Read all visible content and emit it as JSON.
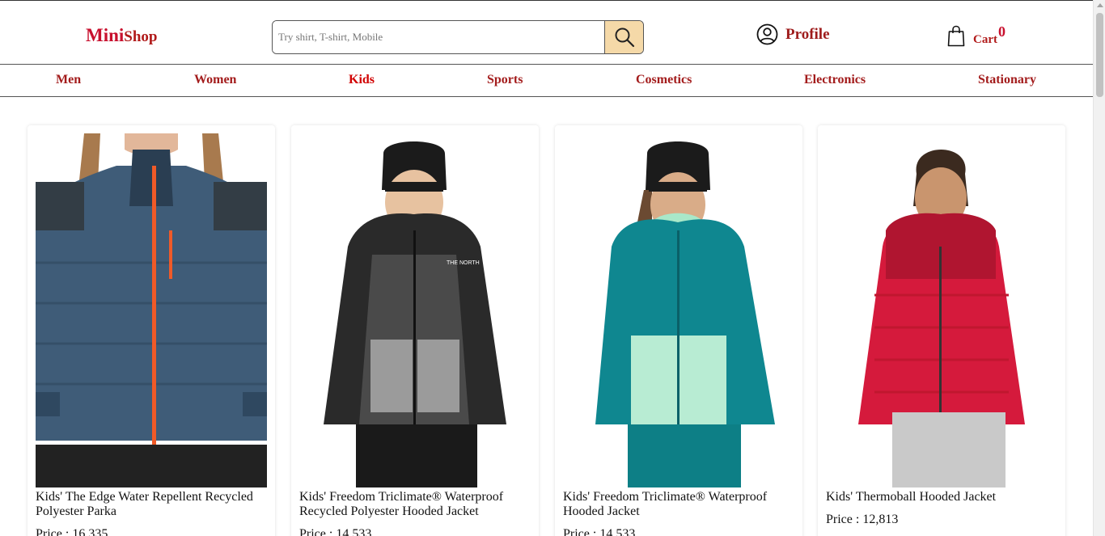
{
  "brand": {
    "mini": "Mini",
    "shop": "Shop"
  },
  "search": {
    "placeholder": "Try shirt, T-shirt, Mobile"
  },
  "header": {
    "profile_label": "Profile",
    "cart_label": "Cart",
    "cart_count": "0"
  },
  "nav": {
    "items": [
      "Men",
      "Women",
      "Kids",
      "Sports",
      "Cosmetics",
      "Electronics",
      "Stationary"
    ],
    "active": "Kids"
  },
  "products": [
    {
      "title": "Kids' The Edge Water Repellent Recycled Polyester Parka",
      "price": "Price : 16,335"
    },
    {
      "title": "Kids' Freedom Triclimate® Waterproof Recycled Polyester Hooded Jacket",
      "price": "Price : 14,533"
    },
    {
      "title": "Kids' Freedom Triclimate® Waterproof Hooded Jacket",
      "price": "Price : 14,533"
    },
    {
      "title": "Kids' Thermoball Hooded Jacket",
      "price": "Price : 12,813"
    }
  ],
  "icons": {
    "search": "search-icon",
    "profile": "user-circle-icon",
    "cart": "shopping-bag-icon"
  },
  "colors": {
    "brand_red": "#c8102e",
    "nav_red": "#a31c1c",
    "search_button": "#f5d9a8"
  }
}
